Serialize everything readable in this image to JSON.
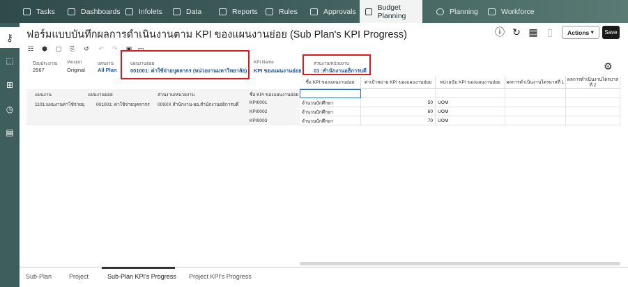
{
  "nav": {
    "tabs": [
      {
        "label": "Tasks",
        "icon": "tasks-icon"
      },
      {
        "label": "Dashboards",
        "icon": "dashboards-icon"
      },
      {
        "label": "Infolets",
        "icon": "infolets-icon"
      },
      {
        "label": "Data",
        "icon": "data-icon"
      },
      {
        "label": "Reports",
        "icon": "reports-icon"
      },
      {
        "label": "Rules",
        "icon": "rules-icon"
      },
      {
        "label": "Approvals",
        "icon": "approvals-icon"
      },
      {
        "label": "Budget Planning",
        "icon": "budget-planning-icon",
        "active": true
      },
      {
        "label": "Planning",
        "icon": "planning-icon"
      },
      {
        "label": "Workforce",
        "icon": "workforce-icon"
      }
    ]
  },
  "page": {
    "title": "ฟอร์มแบบบันทึกผลการดำเนินงานตาม KPI ของแผนงานย่อย (Sub Plan's KPI Progress)",
    "actions_label": "Actions",
    "save_label": "Save"
  },
  "pov": {
    "year_label": "ปีงบประมาณ",
    "year_value": "2567",
    "version_label": "Version",
    "version_value": "Original",
    "plan_label": "แผนงาน",
    "plan_value": "All Plan",
    "subplan_label": "แผนงานย่อย",
    "subplan_value": "001001: ค่าใช้จ่ายบุคลากร (หน่วยงานมหาวิทยาลัย)",
    "kpi_label": "KPI Name",
    "kpi_value": "KPI ของแผนงานย่อย",
    "unit_label": "ส่วนงาน/หน่วยงาน",
    "unit_value": "01 :สำนักงานอธิการบดี"
  },
  "grid": {
    "row_header_labels": [
      "แผนงาน",
      "แผนงานย่อย",
      "ส่วนงาน/หน่วยงาน",
      "ชื่อ KPI ของแผนงานย่อย"
    ],
    "row_header_values": [
      "1101:แผนงานค่าใช้จ่ายบุ",
      "001001: ค่าใช้จ่ายบุคลากร",
      "009XX สำนักงาน-ผอ.สำนักงานอธิการบดี"
    ],
    "columns": [
      "ชื่อ KPI ของแผนงานย่อย",
      "ค่าเป้าหมาย KPI ของแผนงานย่อย",
      "หน่วยนับ KPI ของแผนงานย่อย",
      "ผลการดำเนินงานไตรมาสที่ 1",
      "ผลการดำเนินงานไตรมาสที่ 2"
    ],
    "rows": [
      {
        "kpi": "KPI0001",
        "name": "จำนวนนักศึกษา",
        "target": "50",
        "uom": "UOM"
      },
      {
        "kpi": "KPI0002",
        "name": "จำนวนนักศึกษา",
        "target": "60",
        "uom": "UOM"
      },
      {
        "kpi": "KPI0003",
        "name": "จำนวนนักศึกษา",
        "target": "70",
        "uom": "UOM"
      }
    ]
  },
  "bottom_tabs": [
    "Sub-Plan",
    "Project",
    "Sub-Plan KPI's Progress",
    "Project KPI's Progress"
  ],
  "colors": {
    "nav_bg": "#3d5a58",
    "highlight": "#e0191f",
    "link": "#1c5aa6"
  }
}
